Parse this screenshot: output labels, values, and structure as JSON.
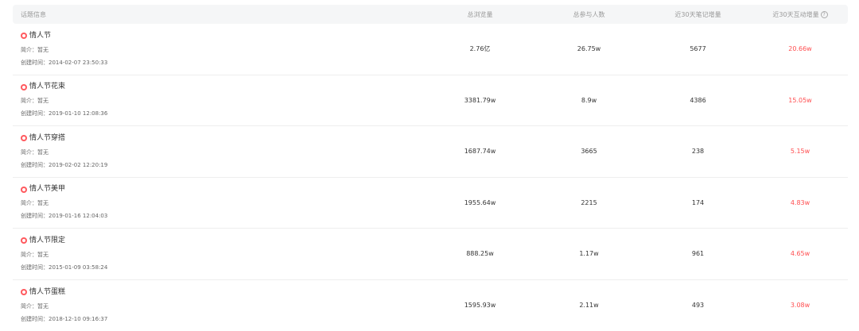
{
  "header": {
    "topic": "话题信息",
    "views": "总浏览量",
    "participants": "总参与人数",
    "notes30": "近30天笔记增量",
    "interactions30": "近30天互动增量"
  },
  "rows": [
    {
      "name": "情人节",
      "intro": "简介：暂无",
      "created": "创建时间：2014-02-07 23:50:33",
      "views": "2.76亿",
      "participants": "26.75w",
      "notes": "5677",
      "interactions": "20.66w"
    },
    {
      "name": "情人节花束",
      "intro": "简介：暂无",
      "created": "创建时间：2019-01-10 12:08:36",
      "views": "3381.79w",
      "participants": "8.9w",
      "notes": "4386",
      "interactions": "15.05w"
    },
    {
      "name": "情人节穿搭",
      "intro": "简介：暂无",
      "created": "创建时间：2019-02-02 12:20:19",
      "views": "1687.74w",
      "participants": "3665",
      "notes": "238",
      "interactions": "5.15w"
    },
    {
      "name": "情人节美甲",
      "intro": "简介：暂无",
      "created": "创建时间：2019-01-16 12:04:03",
      "views": "1955.64w",
      "participants": "2215",
      "notes": "174",
      "interactions": "4.83w"
    },
    {
      "name": "情人节限定",
      "intro": "简介：暂无",
      "created": "创建时间：2015-01-09 03:58:24",
      "views": "888.25w",
      "participants": "1.17w",
      "notes": "961",
      "interactions": "4.65w"
    },
    {
      "name": "情人节蛋糕",
      "intro": "简介：暂无",
      "created": "创建时间：2018-12-10 09:16:37",
      "views": "1595.93w",
      "participants": "2.11w",
      "notes": "493",
      "interactions": "3.08w"
    }
  ],
  "colors": {
    "accent": "#ff4d4f",
    "icon": "#ff5a5f",
    "header_bg": "#f5f6f7"
  },
  "icons": {
    "topic": "topic-hashtag-icon",
    "help": "help-circle-icon"
  }
}
